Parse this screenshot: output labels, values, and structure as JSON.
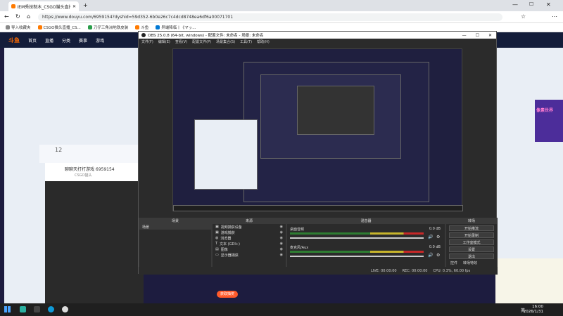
{
  "browser": {
    "tab_title": "IEM秀技制木_CSGO猫头直播_CSGO",
    "url": "https://www.douyu.com/6959154?dyshid=59d352-6b0e26c7c4dcd8748ea6df6a00071701",
    "bookmarks": [
      {
        "label": "导入收藏夹",
        "color": "#888"
      },
      {
        "label": "CSGO猫头直播_CS...",
        "color": "#ff7a00"
      },
      {
        "label": "刀仔三角洲地铁皮装",
        "color": "#2a9d4a"
      },
      {
        "label": "斗鱼",
        "color": "#ff7a00"
      },
      {
        "label": "异端降临丨《マッ...",
        "color": "#0078d4"
      }
    ]
  },
  "douyu": {
    "logo": "斗鱼",
    "nav": [
      "首页",
      "直播",
      "分类",
      "赛事",
      "游戏"
    ],
    "count": "12",
    "room_title": "聊聊天打打游戏 6959154",
    "room_sub": "CSGO猫头",
    "right_promo": "像素世界",
    "bottom_btn": "获取抽奖"
  },
  "obs": {
    "title": "OBS 25.0.8 (64-bit, windows) - 配置文件: 未命名 - 场景: 未命名",
    "menu": [
      "文件(F)",
      "编辑(E)",
      "查看(V)",
      "配置文件(P)",
      "场景集合(S)",
      "工具(T)",
      "帮助(H)"
    ],
    "docks": {
      "scenes": "场景",
      "sources": "来源",
      "mixer": "混音器",
      "transition": "转场",
      "controls": "控件"
    },
    "scene_list": [
      "场景"
    ],
    "sources": [
      {
        "icon": "camera-icon",
        "label": "视频捕获设备"
      },
      {
        "icon": "game-icon",
        "label": "游戏捕获"
      },
      {
        "icon": "browser-icon",
        "label": "浏览器"
      },
      {
        "icon": "text-icon",
        "label": "文本 (GDI+)"
      },
      {
        "icon": "image-icon",
        "label": "图像"
      },
      {
        "icon": "monitor-icon",
        "label": "显示器捕获"
      }
    ],
    "mixer": [
      {
        "name": "桌面音频",
        "db": "0.0 dB"
      },
      {
        "name": "麦克风/Aux",
        "db": "0.0 dB"
      }
    ],
    "control_buttons": [
      "开始推流",
      "开始录制",
      "工作室模式",
      "设置",
      "退出"
    ],
    "bottom_tabs": [
      "控件",
      "转场特效"
    ],
    "status": {
      "live": "LIVE: 00:00:00",
      "rec": "REC: 00:00:00",
      "cpu": "CPU: 0.3%, 60.00 fps"
    }
  },
  "taskbar": {
    "time": "16:00",
    "date": "2026/1/31",
    "lang": "英"
  }
}
